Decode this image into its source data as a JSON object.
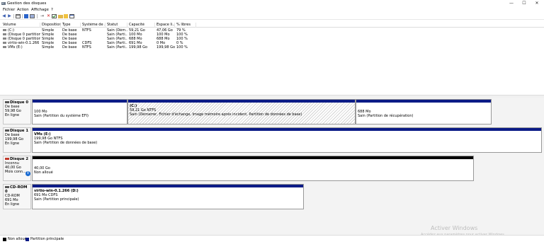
{
  "window": {
    "title": "Gestion des disques",
    "controls": {
      "minimize": "—",
      "maximize": "☐",
      "close": "✕"
    }
  },
  "menu": [
    "Fichier",
    "Action",
    "Affichage",
    "?"
  ],
  "volume_table": {
    "columns": [
      "Volume",
      "Disposition",
      "Type",
      "Système de ...",
      "Statut",
      "Capacité",
      "Espace li...",
      "% libres"
    ],
    "rows": [
      [
        "(C:)",
        "Simple",
        "De base",
        "NTFS",
        "Sain (Dém...",
        "59,21 Go",
        "47,06 Go",
        "79 %"
      ],
      [
        "(Disque 0 partition...",
        "Simple",
        "De base",
        "",
        "Sain (Parti...",
        "100 Mo",
        "100 Mo",
        "100 %"
      ],
      [
        "(Disque 0 partition...",
        "Simple",
        "De base",
        "",
        "Sain (Parti...",
        "688 Mo",
        "688 Mo",
        "100 %"
      ],
      [
        "virtio-win-0.1.266 ...",
        "Simple",
        "De base",
        "CDFS",
        "Sain (Parti...",
        "691 Mo",
        "0 Mo",
        "0 %"
      ],
      [
        "VMs (E:)",
        "Simple",
        "De base",
        "NTFS",
        "Sain (Parti...",
        "199,98 Go",
        "199,98 Go",
        "100 %"
      ]
    ]
  },
  "disks": [
    {
      "name": "Disque 0",
      "kind": "De base",
      "size": "59,98 Go",
      "status": "En ligne",
      "partitions": [
        {
          "title": "",
          "size": "100 Mo",
          "desc": "Sain (Partition du système EFI)"
        },
        {
          "title": "(C:)",
          "size": "59,21 Go NTFS",
          "desc": "Sain (Démarrer, Fichier d'échange, Image mémoire après incident, Partition de données de base)"
        },
        {
          "title": "",
          "size": "688 Mo",
          "desc": "Sain (Partition de récupération)"
        }
      ]
    },
    {
      "name": "Disque 1",
      "kind": "De base",
      "size": "199,98 Go",
      "status": "En ligne",
      "partitions": [
        {
          "title": "VMs (E:)",
          "size": "199,98 Go NTFS",
          "desc": "Sain (Partition de données de base)"
        }
      ]
    },
    {
      "name": "Disque 2",
      "kind": "Inconnu",
      "size": "40,00 Go",
      "status": "Mois conn...",
      "partitions": [
        {
          "title": "",
          "size": "40,00 Go",
          "desc": "Non alloué"
        }
      ]
    },
    {
      "name": "CD-ROM 0",
      "kind": "CD-ROM",
      "size": "691 Mo",
      "status": "En ligne",
      "partitions": [
        {
          "title": "virtio-win-0.1.266 (D:)",
          "size": "691 Mo CDFS",
          "desc": "Sain (Partition principale)"
        }
      ]
    }
  ],
  "legend": [
    {
      "label": "Non alloué",
      "color": "#000000"
    },
    {
      "label": "Partition principale",
      "color": "#0b1b86"
    }
  ],
  "watermark": {
    "title": "Activer Windows",
    "subtitle": "Accédez aux paramètres pour activer Windows."
  }
}
